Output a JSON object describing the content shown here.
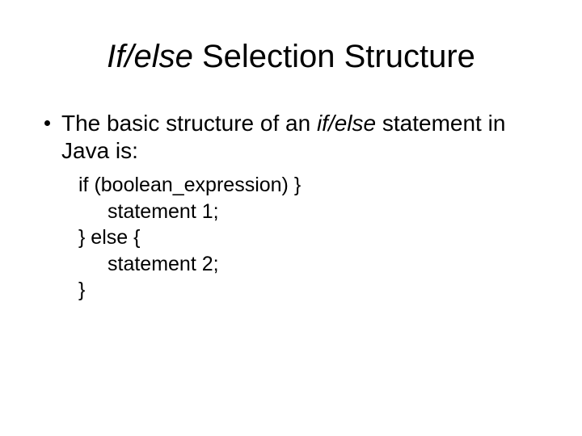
{
  "title": {
    "prefix_italic": "If/else",
    "rest": " Selection Structure"
  },
  "bullet": {
    "part1": "The basic structure of an ",
    "italic": "if/else",
    "part2": " statement in Java is:"
  },
  "code": {
    "l1": "if (boolean_expression) }",
    "l2": "statement 1;",
    "l3": "} else {",
    "l4": "statement 2;",
    "l5": "}"
  }
}
